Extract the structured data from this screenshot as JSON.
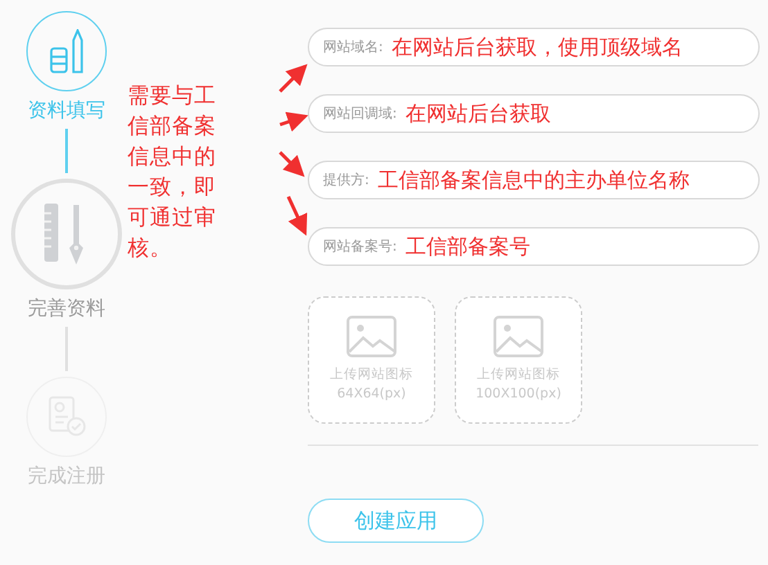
{
  "steps": [
    {
      "label": "资料填写",
      "kind": "fill",
      "selected": true,
      "disabled": false
    },
    {
      "label": "完善资料",
      "kind": "tools",
      "selected": false,
      "disabled": false
    },
    {
      "label": "完成注册",
      "kind": "certificate",
      "selected": false,
      "disabled": true
    }
  ],
  "annotation": "需要与工信部备案信息中的一致，即可通过审核。",
  "fields": [
    {
      "label": "网站域名:",
      "value": "在网站后台获取，使用顶级域名"
    },
    {
      "label": "网站回调域:",
      "value": "在网站后台获取"
    },
    {
      "label": "提供方:",
      "value": "工信部备案信息中的主办单位名称"
    },
    {
      "label": "网站备案号:",
      "value": "工信部备案号"
    }
  ],
  "uploads": [
    {
      "label": "上传网站图标",
      "size": "64X64(px)"
    },
    {
      "label": "上传网站图标",
      "size": "100X100(px)"
    }
  ],
  "submit": "创建应用"
}
